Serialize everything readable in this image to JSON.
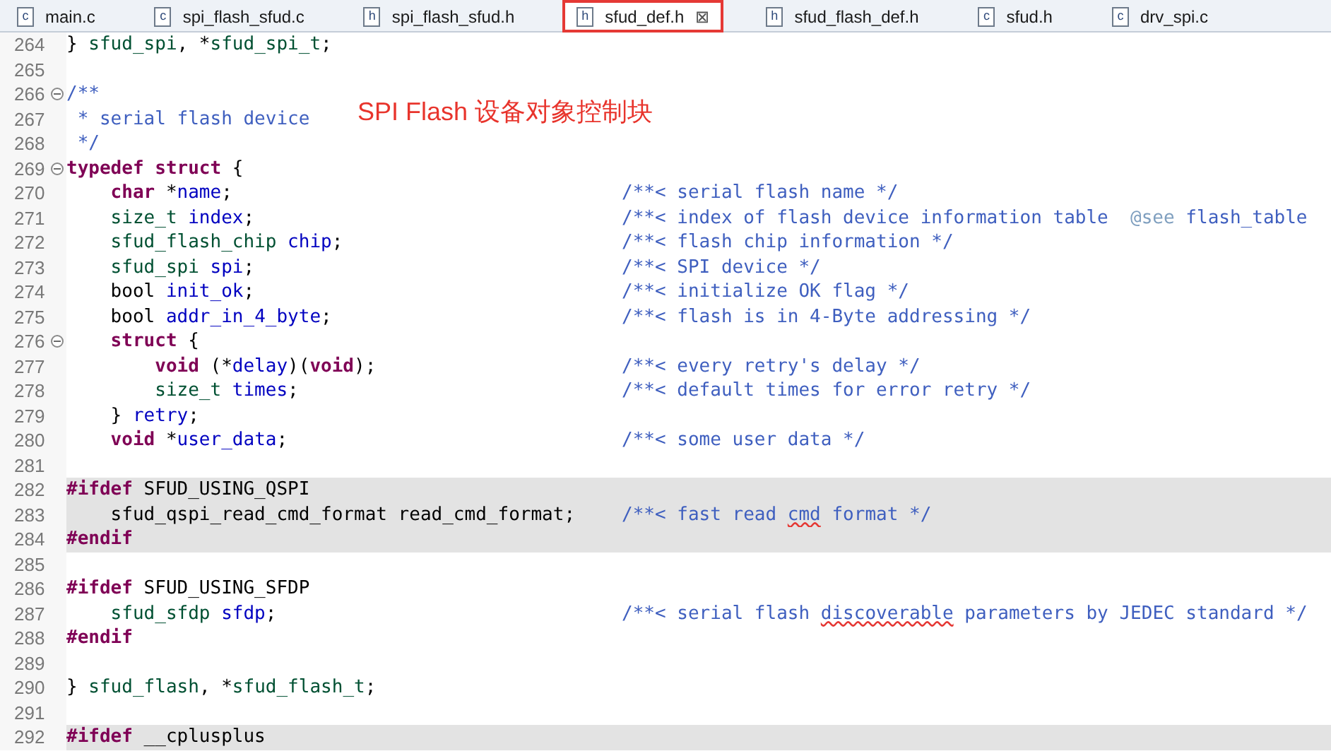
{
  "tabs": [
    {
      "icon_letter": "c",
      "label": "main.c",
      "selected": false
    },
    {
      "icon_letter": "c",
      "label": "spi_flash_sfud.c",
      "selected": false
    },
    {
      "icon_letter": "h",
      "label": "spi_flash_sfud.h",
      "selected": false
    },
    {
      "icon_letter": "h",
      "label": "sfud_def.h",
      "selected": true,
      "close": "⊠"
    },
    {
      "icon_letter": "h",
      "label": "sfud_flash_def.h",
      "selected": false
    },
    {
      "icon_letter": "c",
      "label": "sfud.h",
      "selected": false
    },
    {
      "icon_letter": "c",
      "label": "drv_spi.c",
      "selected": false
    }
  ],
  "annotation": "SPI Flash 设备对象控制块",
  "lines": [
    {
      "number": "264",
      "fold": false,
      "shaded": false,
      "code": [
        {
          "kind": "plain",
          "text": "} "
        },
        {
          "kind": "type",
          "text": "sfud_spi"
        },
        {
          "kind": "plain",
          "text": ", *"
        },
        {
          "kind": "type",
          "text": "sfud_spi_t"
        },
        {
          "kind": "plain",
          "text": ";"
        }
      ]
    },
    {
      "number": "265",
      "fold": false,
      "shaded": false
    },
    {
      "number": "266",
      "fold": true,
      "shaded": false,
      "code": [
        {
          "kind": "comment",
          "text": "/**"
        }
      ]
    },
    {
      "number": "267",
      "fold": false,
      "shaded": false,
      "code": [
        {
          "kind": "comment",
          "text": " * serial flash device"
        }
      ]
    },
    {
      "number": "268",
      "fold": false,
      "shaded": false,
      "code": [
        {
          "kind": "comment",
          "text": " */"
        }
      ]
    },
    {
      "number": "269",
      "fold": true,
      "shaded": false,
      "code": [
        {
          "kind": "keyword",
          "text": "typedef struct"
        },
        {
          "kind": "plain",
          "text": " {"
        }
      ]
    },
    {
      "number": "270",
      "fold": false,
      "shaded": false,
      "code": [
        {
          "kind": "keyword",
          "text": "    char"
        },
        {
          "kind": "plain",
          "text": " *"
        },
        {
          "kind": "field",
          "text": "name"
        },
        {
          "kind": "plain",
          "text": ";"
        }
      ],
      "doc": [
        {
          "kind": "comment",
          "text": "/**< serial flash name */"
        }
      ]
    },
    {
      "number": "271",
      "fold": false,
      "shaded": false,
      "code": [
        {
          "kind": "type",
          "text": "    size_t"
        },
        {
          "kind": "field",
          "text": " index"
        },
        {
          "kind": "plain",
          "text": ";"
        }
      ],
      "doc": [
        {
          "kind": "comment",
          "text": "/**< index of flash device information table  "
        },
        {
          "kind": "tag",
          "text": "@see"
        },
        {
          "kind": "comment",
          "text": " flash_table"
        }
      ]
    },
    {
      "number": "272",
      "fold": false,
      "shaded": false,
      "code": [
        {
          "kind": "type",
          "text": "    sfud_flash_chip"
        },
        {
          "kind": "field",
          "text": " chip"
        },
        {
          "kind": "plain",
          "text": ";"
        }
      ],
      "doc": [
        {
          "kind": "comment",
          "text": "/**< flash chip information */"
        }
      ]
    },
    {
      "number": "273",
      "fold": false,
      "shaded": false,
      "code": [
        {
          "kind": "type",
          "text": "    sfud_spi"
        },
        {
          "kind": "field",
          "text": " spi"
        },
        {
          "kind": "plain",
          "text": ";"
        }
      ],
      "doc": [
        {
          "kind": "comment",
          "text": "/**< SPI device */"
        }
      ]
    },
    {
      "number": "274",
      "fold": false,
      "shaded": false,
      "code": [
        {
          "kind": "plain",
          "text": "    bool"
        },
        {
          "kind": "field",
          "text": " init_ok"
        },
        {
          "kind": "plain",
          "text": ";"
        }
      ],
      "doc": [
        {
          "kind": "comment",
          "text": "/**< initialize OK flag */"
        }
      ]
    },
    {
      "number": "275",
      "fold": false,
      "shaded": false,
      "code": [
        {
          "kind": "plain",
          "text": "    bool"
        },
        {
          "kind": "field",
          "text": " addr_in_4_byte"
        },
        {
          "kind": "plain",
          "text": ";"
        }
      ],
      "doc": [
        {
          "kind": "comment",
          "text": "/**< flash is in 4-Byte addressing */"
        }
      ]
    },
    {
      "number": "276",
      "fold": true,
      "shaded": false,
      "code": [
        {
          "kind": "keyword",
          "text": "    struct"
        },
        {
          "kind": "plain",
          "text": " {"
        }
      ]
    },
    {
      "number": "277",
      "fold": false,
      "shaded": false,
      "code": [
        {
          "kind": "keyword",
          "text": "        void"
        },
        {
          "kind": "plain",
          "text": " (*"
        },
        {
          "kind": "field",
          "text": "delay"
        },
        {
          "kind": "plain",
          "text": ")("
        },
        {
          "kind": "keyword",
          "text": "void"
        },
        {
          "kind": "plain",
          "text": ");"
        }
      ],
      "doc": [
        {
          "kind": "comment",
          "text": "/**< every retry's delay */"
        }
      ]
    },
    {
      "number": "278",
      "fold": false,
      "shaded": false,
      "code": [
        {
          "kind": "type",
          "text": "        size_t"
        },
        {
          "kind": "field",
          "text": " times"
        },
        {
          "kind": "plain",
          "text": ";"
        }
      ],
      "doc": [
        {
          "kind": "comment",
          "text": "/**< default times for error retry */"
        }
      ]
    },
    {
      "number": "279",
      "fold": false,
      "shaded": false,
      "code": [
        {
          "kind": "plain",
          "text": "    }"
        },
        {
          "kind": "field",
          "text": " retry"
        },
        {
          "kind": "plain",
          "text": ";"
        }
      ]
    },
    {
      "number": "280",
      "fold": false,
      "shaded": false,
      "code": [
        {
          "kind": "keyword",
          "text": "    void"
        },
        {
          "kind": "plain",
          "text": " *"
        },
        {
          "kind": "field",
          "text": "user_data"
        },
        {
          "kind": "plain",
          "text": ";"
        }
      ],
      "doc": [
        {
          "kind": "comment",
          "text": "/**< some user data */"
        }
      ]
    },
    {
      "number": "281",
      "fold": false,
      "shaded": false
    },
    {
      "number": "282",
      "fold": false,
      "shaded": true,
      "code": [
        {
          "kind": "keyword",
          "text": "#ifdef"
        },
        {
          "kind": "plain",
          "text": " SFUD_USING_QSPI"
        }
      ]
    },
    {
      "number": "283",
      "fold": false,
      "shaded": true,
      "code": [
        {
          "kind": "plain",
          "text": "    sfud_qspi_read_cmd_format read_cmd_format;"
        }
      ],
      "doc": [
        {
          "kind": "comment",
          "text": "/**< fast read "
        },
        {
          "kind": "misspelled",
          "text": "cmd"
        },
        {
          "kind": "comment",
          "text": " format */"
        }
      ]
    },
    {
      "number": "284",
      "fold": false,
      "shaded": true,
      "code": [
        {
          "kind": "keyword",
          "text": "#endif"
        }
      ]
    },
    {
      "number": "285",
      "fold": false,
      "shaded": false
    },
    {
      "number": "286",
      "fold": false,
      "shaded": false,
      "code": [
        {
          "kind": "keyword",
          "text": "#ifdef"
        },
        {
          "kind": "plain",
          "text": " SFUD_USING_SFDP"
        }
      ]
    },
    {
      "number": "287",
      "fold": false,
      "shaded": false,
      "code": [
        {
          "kind": "type",
          "text": "    sfud_sfdp"
        },
        {
          "kind": "field",
          "text": " sfdp"
        },
        {
          "kind": "plain",
          "text": ";"
        }
      ],
      "doc": [
        {
          "kind": "comment",
          "text": "/**< serial flash "
        },
        {
          "kind": "misspelled",
          "text": "discoverable"
        },
        {
          "kind": "comment",
          "text": " parameters by JEDEC standard */"
        }
      ]
    },
    {
      "number": "288",
      "fold": false,
      "shaded": false,
      "code": [
        {
          "kind": "keyword",
          "text": "#endif"
        }
      ]
    },
    {
      "number": "289",
      "fold": false,
      "shaded": false
    },
    {
      "number": "290",
      "fold": false,
      "shaded": false,
      "code": [
        {
          "kind": "plain",
          "text": "} "
        },
        {
          "kind": "type",
          "text": "sfud_flash"
        },
        {
          "kind": "plain",
          "text": ", *"
        },
        {
          "kind": "type",
          "text": "sfud_flash_t"
        },
        {
          "kind": "plain",
          "text": ";"
        }
      ]
    },
    {
      "number": "291",
      "fold": false,
      "shaded": false
    },
    {
      "number": "292",
      "fold": false,
      "shaded": true,
      "code": [
        {
          "kind": "keyword",
          "text": "#ifdef"
        },
        {
          "kind": "plain",
          "text": " __cplusplus"
        }
      ]
    }
  ]
}
